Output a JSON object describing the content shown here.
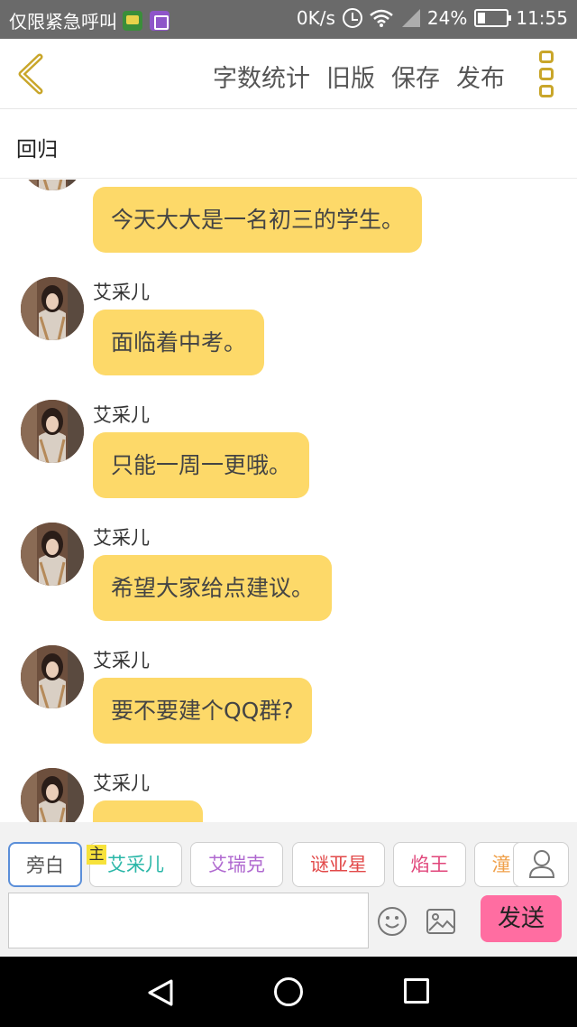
{
  "status_bar": {
    "carrier": "仅限紧急呼叫",
    "speed": "0K/s",
    "battery": "24%",
    "time": "11:55"
  },
  "header": {
    "actions": [
      "字数统计",
      "旧版",
      "保存",
      "发布"
    ],
    "accent_color": "#c9a62a"
  },
  "chapter": {
    "title": "回归"
  },
  "messages": [
    {
      "name": "",
      "text": "今天大大是一名初三的学生。"
    },
    {
      "name": "艾采儿",
      "text": "面临着中考。"
    },
    {
      "name": "艾采儿",
      "text": "只能一周一更哦。"
    },
    {
      "name": "艾采儿",
      "text": "希望大家给点建议。"
    },
    {
      "name": "艾采儿",
      "text": "要不要建个QQ群?"
    },
    {
      "name": "艾采儿",
      "text": ""
    }
  ],
  "composer": {
    "characters": [
      {
        "label": "旁白",
        "color": "#555555",
        "selected": true
      },
      {
        "label": "艾采儿",
        "color": "#2bb7a8",
        "selected": false
      },
      {
        "label": "艾瑞克",
        "color": "#b06ad0",
        "selected": false
      },
      {
        "label": "谜亚星",
        "color": "#e24a4a",
        "selected": false
      },
      {
        "label": "焰王",
        "color": "#e0457a",
        "selected": false
      },
      {
        "label": "潼",
        "color": "#f0a04a",
        "selected": false
      }
    ],
    "host_badge": "主",
    "input_value": "",
    "send_label": "发送",
    "send_color": "#ff6da1",
    "bubble_color": "#fdd969"
  }
}
